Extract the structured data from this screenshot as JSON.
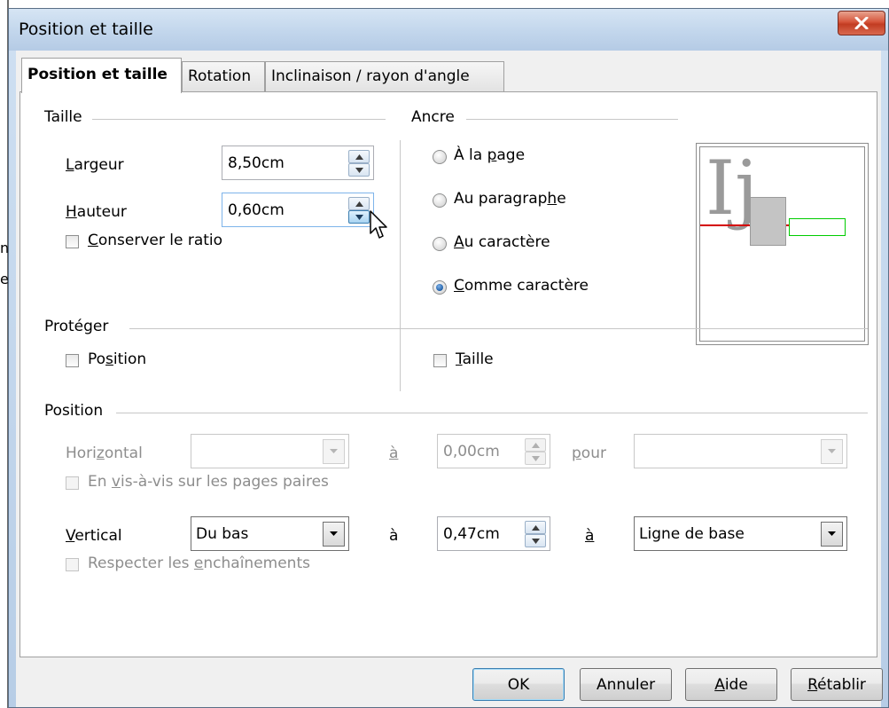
{
  "background": {
    "fragment_line1": "n",
    "fragment_line2": "e"
  },
  "dialog": {
    "title": "Position et taille",
    "close_icon": "close-x-icon"
  },
  "tabs": [
    {
      "label": "Position et taille",
      "active": true
    },
    {
      "label": "Rotation",
      "active": false
    },
    {
      "label": "Inclinaison / rayon d'angle",
      "active": false
    }
  ],
  "taille": {
    "group_label": "Taille",
    "largeur_label": "Largeur",
    "largeur_value": "8,50cm",
    "hauteur_label": "Hauteur",
    "hauteur_value": "0,60cm",
    "keep_ratio_label": "Conserver le ratio",
    "keep_ratio_checked": false
  },
  "ancre": {
    "group_label": "Ancre",
    "options": [
      {
        "label": "À la page",
        "selected": false
      },
      {
        "label": "Au paragraphe",
        "selected": false
      },
      {
        "label": "Au caractère",
        "selected": false
      },
      {
        "label": "Comme caractère",
        "selected": true
      }
    ]
  },
  "preview": {
    "sample_text": "Ij",
    "baseline_color": "#d40000",
    "object_color": "#00cc00"
  },
  "proteger": {
    "group_label": "Protéger",
    "position_label": "Position",
    "taille_label": "Taille"
  },
  "position": {
    "group_label": "Position",
    "horizontal_label": "Horizontal",
    "horizontal_value": "",
    "a_label_1": "à",
    "horizontal_offset": "0,00cm",
    "pour_label": "pour",
    "pour_value": "",
    "mirror_label": "En vis-à-vis sur les pages paires",
    "vertical_label": "Vertical",
    "vertical_value": "Du bas",
    "a_label_2": "à",
    "vertical_offset": "0,47cm",
    "a_label_3": "à",
    "vertical_to_value": "Ligne de base",
    "follow_label": "Respecter les enchaînements"
  },
  "buttons": {
    "ok": "OK",
    "cancel": "Annuler",
    "help": "Aide",
    "reset": "Rétablir"
  }
}
